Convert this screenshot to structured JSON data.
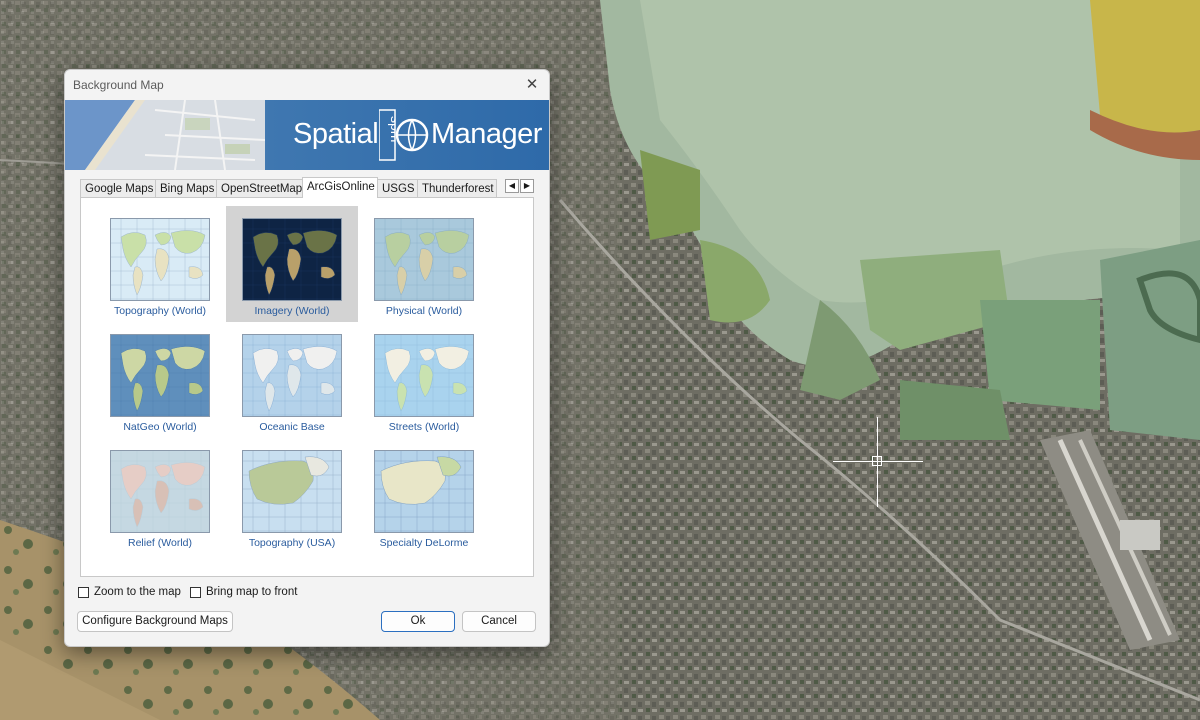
{
  "dialog": {
    "title": "Background Map",
    "close_glyph": "✕",
    "banner": {
      "left_word": "Spatial",
      "mark": "spm",
      "right_word": "Manager"
    }
  },
  "tabs": [
    {
      "label": "Google Maps",
      "active": false
    },
    {
      "label": "Bing Maps",
      "active": false
    },
    {
      "label": "OpenStreetMap",
      "active": false
    },
    {
      "label": "ArcGisOnline",
      "active": true
    },
    {
      "label": "USGS",
      "active": false
    },
    {
      "label": "Thunderforest",
      "active": false
    }
  ],
  "tab_scroll": {
    "left_icon": "arrow-left-icon",
    "right_icon": "arrow-right-icon",
    "left_glyph": "◀",
    "right_glyph": "▶"
  },
  "maps": [
    {
      "label": "Topography (World)",
      "selected": false,
      "style": "topo"
    },
    {
      "label": "Imagery (World)",
      "selected": true,
      "style": "imagery"
    },
    {
      "label": "Physical (World)",
      "selected": false,
      "style": "physical"
    },
    {
      "label": "NatGeo (World)",
      "selected": false,
      "style": "natgeo"
    },
    {
      "label": "Oceanic Base",
      "selected": false,
      "style": "oceanic"
    },
    {
      "label": "Streets (World)",
      "selected": false,
      "style": "streets"
    },
    {
      "label": "Relief (World)",
      "selected": false,
      "style": "relief"
    },
    {
      "label": "Topography (USA)",
      "selected": false,
      "style": "topousa"
    },
    {
      "label": "Specialty DeLorme",
      "selected": false,
      "style": "delorme"
    }
  ],
  "options": {
    "zoom_to_map": {
      "label": "Zoom to the map",
      "checked": false
    },
    "bring_to_front": {
      "label": "Bring map to front",
      "checked": false
    }
  },
  "buttons": {
    "configure": "Configure Background Maps",
    "ok": "Ok",
    "cancel": "Cancel"
  },
  "colors": {
    "selection": "#d3d3d3",
    "caption": "#2a5c9e",
    "banner_blue": "#2e6aa9",
    "ok_border": "#2b6fc0"
  }
}
